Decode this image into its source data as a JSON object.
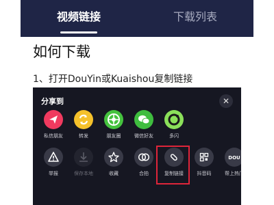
{
  "tabs": [
    {
      "label": "视频链接",
      "active": true
    },
    {
      "label": "下载列表",
      "active": false
    }
  ],
  "heading": "如何下载",
  "step1": "1、打开DouYin或Kuaishou复制链接",
  "share_panel": {
    "title": "分享到",
    "close_symbol": "✕",
    "row1": [
      {
        "label": "私信朋友",
        "icon": "send-icon",
        "color": "#f03a5f"
      },
      {
        "label": "转发",
        "icon": "repost-icon",
        "color": "#f5c12b"
      },
      {
        "label": "朋友圈",
        "icon": "moments-icon",
        "color": "#45c23e"
      },
      {
        "label": "微信好友",
        "icon": "wechat-icon",
        "color": "#3fbd3f"
      },
      {
        "label": "多闪",
        "icon": "duoshan-icon",
        "color": "#8be05a"
      }
    ],
    "row2": [
      {
        "label": "举报",
        "icon": "warning-icon"
      },
      {
        "label": "保存本地",
        "icon": "download-icon"
      },
      {
        "label": "收藏",
        "icon": "star-icon"
      },
      {
        "label": "合拍",
        "icon": "duet-icon"
      },
      {
        "label": "复制链接",
        "icon": "link-icon"
      },
      {
        "label": "抖音码",
        "icon": "qr-code-icon"
      },
      {
        "label": "帮上热门",
        "icon": "dou-plus-icon",
        "badge": "DOU"
      }
    ]
  },
  "highlight_color": "#e0253a"
}
